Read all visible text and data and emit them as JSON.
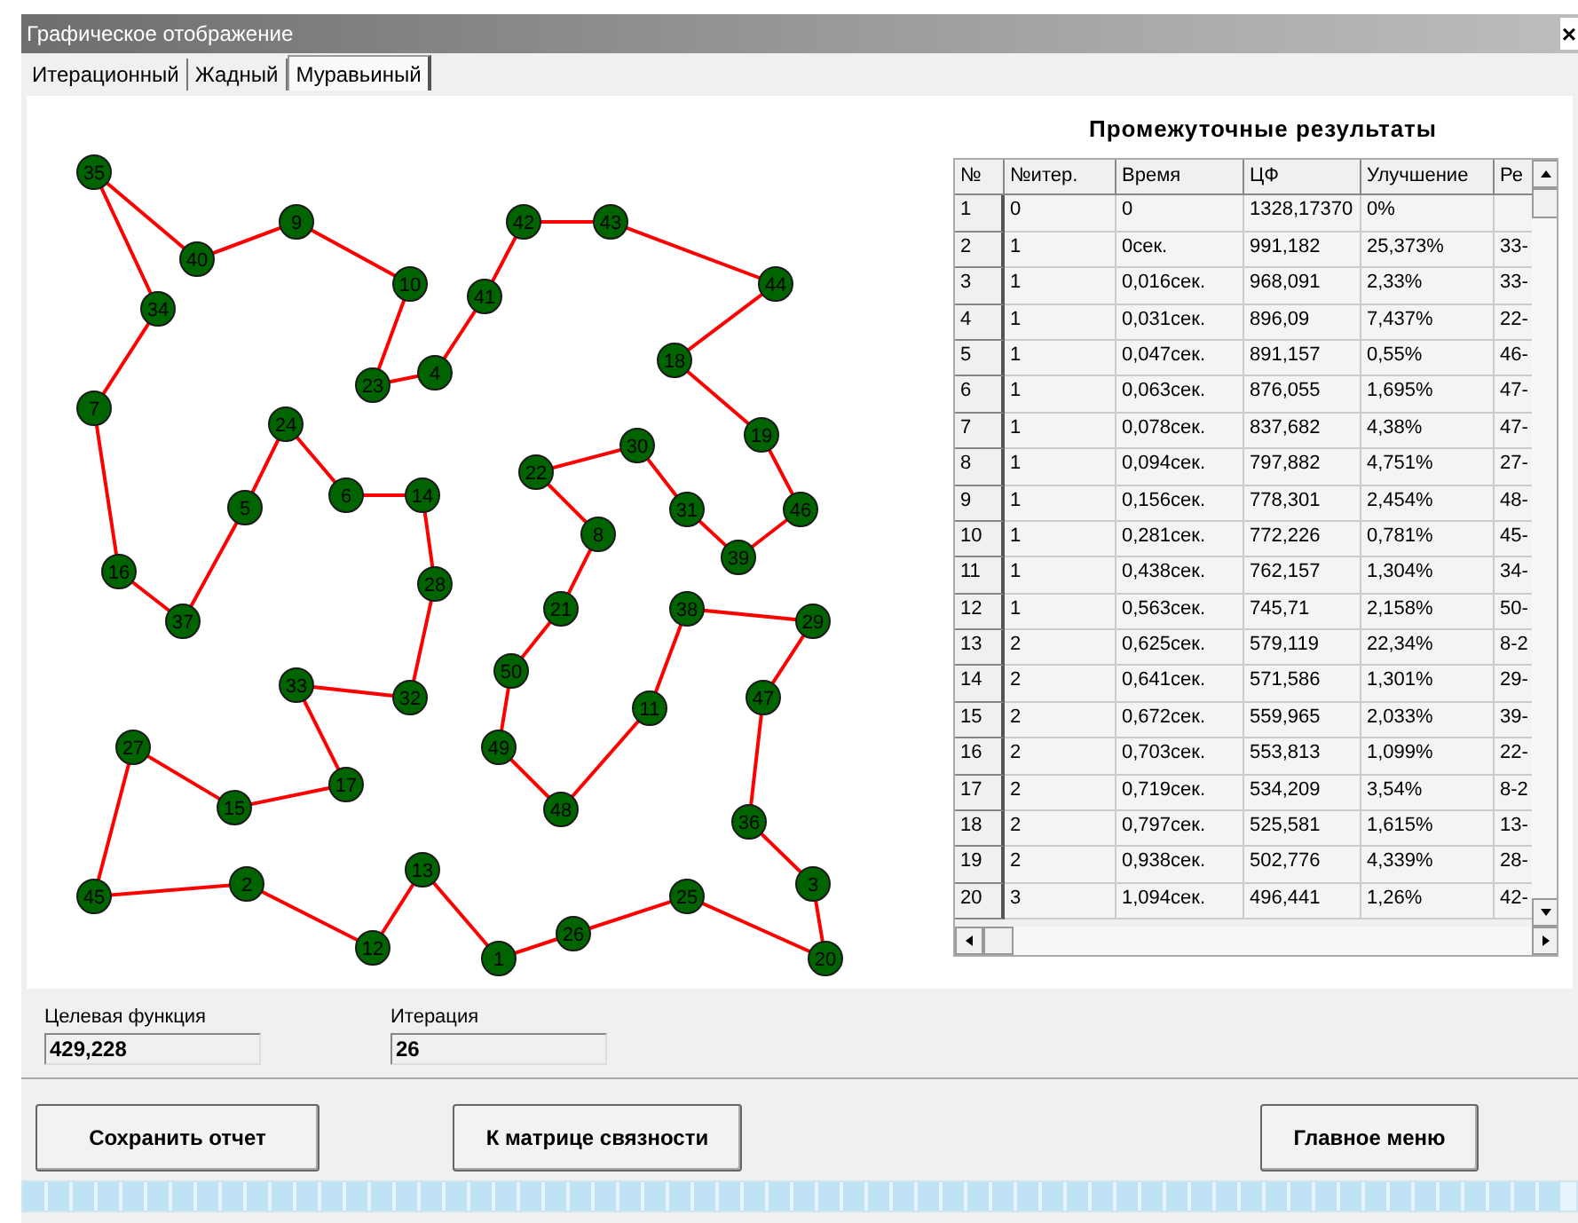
{
  "window": {
    "title": "Графическое отображение",
    "close": "×"
  },
  "tabs": [
    {
      "label": "Итерационный",
      "selected": false
    },
    {
      "label": "Жадный",
      "selected": false
    },
    {
      "label": "Муравьиный",
      "selected": true
    }
  ],
  "graph": {
    "tour": [
      "35",
      "40",
      "9",
      "10",
      "23",
      "4",
      "41",
      "42",
      "43",
      "44",
      "18",
      "19",
      "46",
      "39",
      "31",
      "30",
      "22",
      "8",
      "21",
      "50",
      "49",
      "48",
      "11",
      "38",
      "29",
      "47",
      "36",
      "3",
      "20",
      "25",
      "26",
      "1",
      "13",
      "12",
      "2",
      "45",
      "27",
      "15",
      "17",
      "33",
      "32",
      "28",
      "14",
      "6",
      "24",
      "5",
      "37",
      "16",
      "7",
      "34"
    ]
  },
  "results": {
    "title": "Промежуточные результаты",
    "columns": [
      "№",
      "№итер.",
      "Время",
      "ЦФ",
      "Улучшение",
      "Ре"
    ],
    "rows": [
      [
        "1",
        "0",
        "0",
        "1328,17370",
        "0%",
        ""
      ],
      [
        "2",
        "1",
        "0сек.",
        "991,182",
        "25,373%",
        "33-"
      ],
      [
        "3",
        "1",
        "0,016сек.",
        "968,091",
        "2,33%",
        "33-"
      ],
      [
        "4",
        "1",
        "0,031сек.",
        "896,09",
        "7,437%",
        "22-"
      ],
      [
        "5",
        "1",
        "0,047сек.",
        "891,157",
        "0,55%",
        "46-"
      ],
      [
        "6",
        "1",
        "0,063сек.",
        "876,055",
        "1,695%",
        "47-"
      ],
      [
        "7",
        "1",
        "0,078сек.",
        "837,682",
        "4,38%",
        "47-"
      ],
      [
        "8",
        "1",
        "0,094сек.",
        "797,882",
        "4,751%",
        "27-"
      ],
      [
        "9",
        "1",
        "0,156сек.",
        "778,301",
        "2,454%",
        "48-"
      ],
      [
        "10",
        "1",
        "0,281сек.",
        "772,226",
        "0,781%",
        "45-"
      ],
      [
        "11",
        "1",
        "0,438сек.",
        "762,157",
        "1,304%",
        "34-"
      ],
      [
        "12",
        "1",
        "0,563сек.",
        "745,71",
        "2,158%",
        "50-"
      ],
      [
        "13",
        "2",
        "0,625сек.",
        "579,119",
        "22,34%",
        "8-2"
      ],
      [
        "14",
        "2",
        "0,641сек.",
        "571,586",
        "1,301%",
        "29-"
      ],
      [
        "15",
        "2",
        "0,672сек.",
        "559,965",
        "2,033%",
        "39-"
      ],
      [
        "16",
        "2",
        "0,703сек.",
        "553,813",
        "1,099%",
        "22-"
      ],
      [
        "17",
        "2",
        "0,719сек.",
        "534,209",
        "3,54%",
        "8-2"
      ],
      [
        "18",
        "2",
        "0,797сек.",
        "525,581",
        "1,615%",
        "13-"
      ],
      [
        "19",
        "2",
        "0,938сек.",
        "502,776",
        "4,339%",
        "28-"
      ],
      [
        "20",
        "3",
        "1,094сек.",
        "496,441",
        "1,26%",
        "42-"
      ]
    ]
  },
  "fields": [
    {
      "label": "Целевая функция",
      "value": "429,228"
    },
    {
      "label": "Итерация",
      "value": "26"
    }
  ],
  "buttons": [
    "Сохранить отчет",
    "К матрице связности",
    "Главное меню"
  ],
  "progress": {
    "level": 1
  }
}
